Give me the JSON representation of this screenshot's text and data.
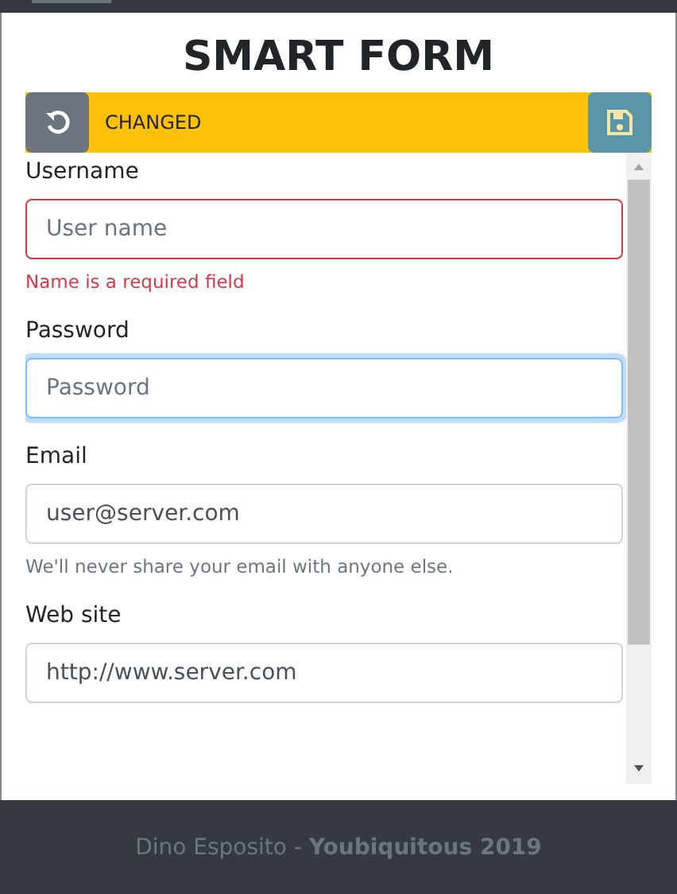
{
  "title": "SMART FORM",
  "status": {
    "text": "CHANGED",
    "changed": true
  },
  "fields": [
    {
      "label": "Username",
      "placeholder": "User name",
      "invalid": true,
      "focused": false,
      "message": {
        "kind": "error",
        "text": "Name is a required field"
      }
    },
    {
      "label": "Password",
      "placeholder": "Password",
      "invalid": false,
      "focused": true
    },
    {
      "label": "Email",
      "value": "user@server.com",
      "invalid": false,
      "focused": false,
      "message": {
        "kind": "help",
        "text": "We'll never share your email with anyone else."
      }
    },
    {
      "label": "Web site",
      "value": "http://www.server.com",
      "invalid": false,
      "focused": false
    }
  ],
  "footer": {
    "author": "Dino Esposito - ",
    "event": "Youbiquitous 2019"
  }
}
